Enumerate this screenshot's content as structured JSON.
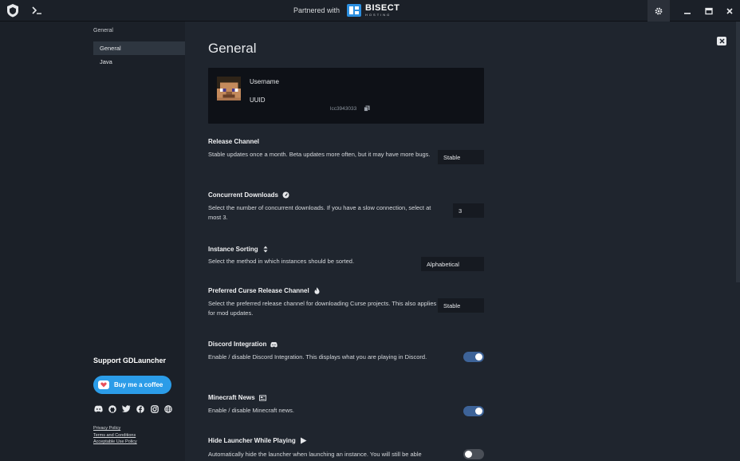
{
  "titlebar": {
    "partnered_with": "Partnered with",
    "partner_name": "BISECT",
    "partner_sub": "HOSTING",
    "icons": [
      "gdlauncher-logo-icon",
      "terminal-icon",
      "gear-icon",
      "minimize-icon",
      "maximize-icon",
      "close-icon"
    ]
  },
  "sidebar": {
    "heading": "General",
    "items": [
      {
        "label": "General",
        "active": true
      },
      {
        "label": "Java",
        "active": false
      }
    ],
    "support_title": "Support GDLauncher",
    "coffee_button": "Buy me a coffee",
    "socials": [
      "discord-icon",
      "github-icon",
      "twitter-icon",
      "facebook-icon",
      "instagram-icon",
      "globe-icon"
    ],
    "legal": [
      "Privacy Policy",
      "Terms and Conditions",
      "Acceptable Use Policy"
    ]
  },
  "main": {
    "title": "General",
    "account": {
      "username_label": "Username",
      "uuid_label": "UUID",
      "uuid_value": "lcc3943033"
    },
    "settings": [
      {
        "title": "Release Channel",
        "desc": "Stable updates once a month. Beta updates more often, but it may have more bugs.",
        "control": "select",
        "value": "Stable",
        "icon": ""
      },
      {
        "title": "Concurrent Downloads",
        "desc": "Select the number of concurrent downloads. If you have a slow connection, select at most 3.",
        "control": "select",
        "value": "3",
        "icon": "gauge-icon"
      },
      {
        "title": "Instance Sorting",
        "desc": "Select the method in which instances should be sorted.",
        "control": "select",
        "value": "Alphabetical",
        "icon": "sort-icon"
      },
      {
        "title": "Preferred Curse Release Channel",
        "desc": "Select the preferred release channel for downloading Curse projects. This also applies for mod updates.",
        "control": "select",
        "value": "Stable",
        "icon": "fire-icon"
      },
      {
        "title": "Discord Integration",
        "desc": "Enable / disable Discord Integration. This displays what you are playing in Discord.",
        "control": "toggle",
        "on": true,
        "icon": "discord-icon"
      },
      {
        "title": "Minecraft News",
        "desc": "Enable / disable Minecraft news.",
        "control": "toggle",
        "on": true,
        "icon": "newspaper-icon"
      },
      {
        "title": "Hide Launcher While Playing",
        "desc": "Automatically hide the launcher when launching an instance. You will still be able",
        "control": "toggle",
        "on": false,
        "icon": "play-icon"
      }
    ]
  },
  "colors": {
    "accent": "#2b9ce8",
    "toggle_on": "#3d6398",
    "panel": "#1f252e",
    "sidebar": "#1b2028"
  }
}
